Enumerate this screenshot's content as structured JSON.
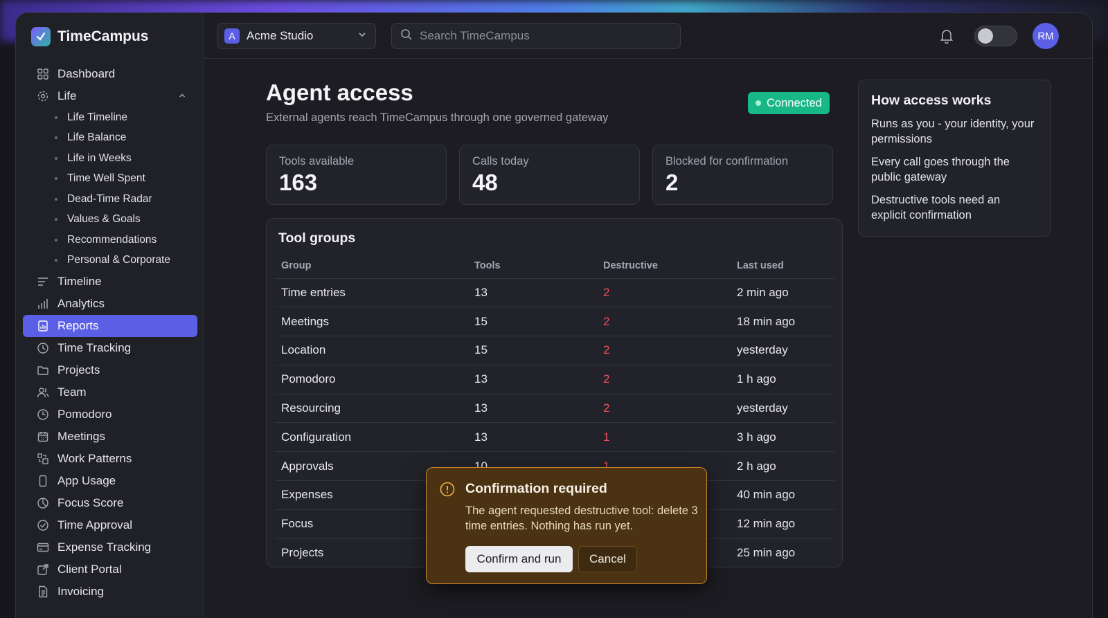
{
  "app": {
    "name": "TimeCampus"
  },
  "sidebar": {
    "items": [
      {
        "label": "Dashboard",
        "icon": "grid-icon"
      },
      {
        "label": "Life",
        "icon": "gear-icon",
        "expanded": true,
        "children": [
          "Life Timeline",
          "Life Balance",
          "Life in Weeks",
          "Time Well Spent",
          "Dead-Time Radar",
          "Values & Goals",
          "Recommendations",
          "Personal & Corporate"
        ]
      },
      {
        "label": "Timeline",
        "icon": "lines-icon"
      },
      {
        "label": "Analytics",
        "icon": "bar-chart-icon"
      },
      {
        "label": "Reports",
        "icon": "report-icon",
        "active": true
      },
      {
        "label": "Time Tracking",
        "icon": "clock-icon"
      },
      {
        "label": "Projects",
        "icon": "folder-icon"
      },
      {
        "label": "Team",
        "icon": "users-icon"
      },
      {
        "label": "Pomodoro",
        "icon": "timer-icon"
      },
      {
        "label": "Meetings",
        "icon": "calendar-icon"
      },
      {
        "label": "Work Patterns",
        "icon": "pattern-icon"
      },
      {
        "label": "App Usage",
        "icon": "phone-icon"
      },
      {
        "label": "Focus Score",
        "icon": "pie-icon"
      },
      {
        "label": "Time Approval",
        "icon": "check-circle-icon"
      },
      {
        "label": "Expense Tracking",
        "icon": "card-icon"
      },
      {
        "label": "Client Portal",
        "icon": "portal-icon"
      },
      {
        "label": "Invoicing",
        "icon": "document-icon"
      }
    ]
  },
  "header": {
    "workspace": {
      "badge": "A",
      "name": "Acme Studio"
    },
    "search_placeholder": "Search TimeCampus",
    "avatar_initials": "RM"
  },
  "page": {
    "title": "Agent access",
    "subtitle": "External agents reach TimeCampus through one governed gateway",
    "status": "Connected",
    "status_color": "#17b886"
  },
  "stats": [
    {
      "label": "Tools available",
      "value": "163"
    },
    {
      "label": "Calls today",
      "value": "48"
    },
    {
      "label": "Blocked for confirmation",
      "value": "2"
    }
  ],
  "tool_groups": {
    "title": "Tool groups",
    "columns": [
      "Group",
      "Tools",
      "Destructive",
      "Last used"
    ],
    "rows": [
      [
        "Time entries",
        "13",
        "2",
        "2 min ago"
      ],
      [
        "Meetings",
        "15",
        "2",
        "18 min ago"
      ],
      [
        "Location",
        "15",
        "2",
        "yesterday"
      ],
      [
        "Pomodoro",
        "13",
        "2",
        "1 h ago"
      ],
      [
        "Resourcing",
        "13",
        "2",
        "yesterday"
      ],
      [
        "Configuration",
        "13",
        "1",
        "3 h ago"
      ],
      [
        "Approvals",
        "10",
        "1",
        "2 h ago"
      ],
      [
        "Expenses",
        "",
        "",
        "40 min ago"
      ],
      [
        "Focus",
        "",
        "",
        "12 min ago"
      ],
      [
        "Projects",
        "",
        "",
        "25 min ago"
      ]
    ]
  },
  "how_access": {
    "title": "How access works",
    "points": [
      "Runs as you - your identity, your permissions",
      "Every call goes through the public gateway",
      "Destructive tools need an explicit confirmation"
    ]
  },
  "confirmation": {
    "title": "Confirmation required",
    "message": "The agent requested destructive tool: delete 3 time entries. Nothing has run yet.",
    "confirm_label": "Confirm and run",
    "cancel_label": "Cancel"
  }
}
